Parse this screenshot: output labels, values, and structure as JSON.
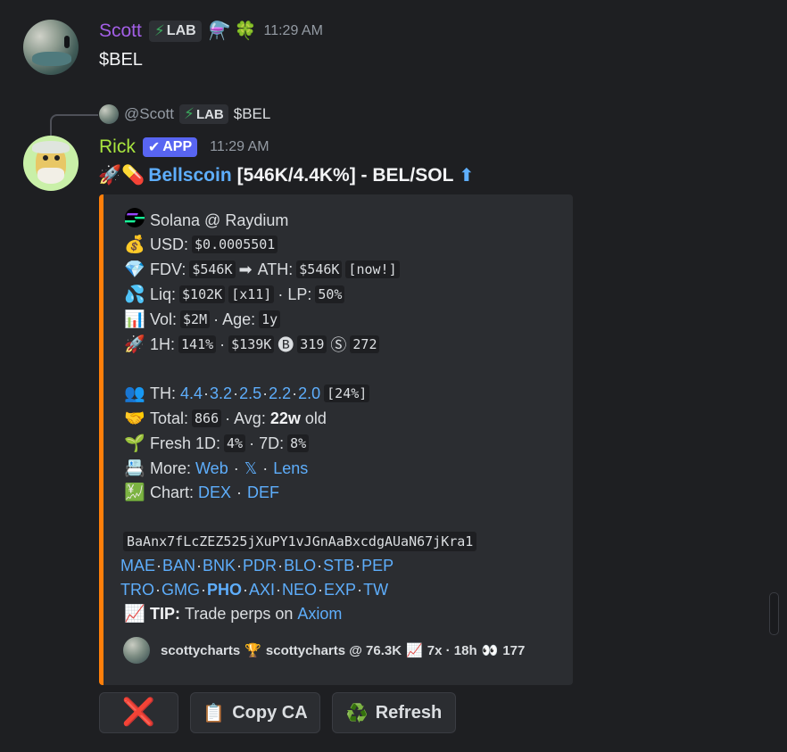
{
  "message1": {
    "author": "Scott",
    "author_color": "#a35fe6",
    "tag": "LAB",
    "badges": [
      "⚗️",
      "🍀"
    ],
    "time": "11:29 AM",
    "text": "$BEL"
  },
  "reply": {
    "mention": "@Scott",
    "tag": "LAB",
    "text": "$BEL"
  },
  "message2": {
    "author": "Rick",
    "author_color": "#a9e63f",
    "app_tag": "APP",
    "time": "11:29 AM",
    "title_emoji": "🚀💊",
    "title_link": "Bellscoin",
    "title_rest": "[546K/4.4K%] - BEL/SOL",
    "title_arrow": "⬆"
  },
  "embed": {
    "accent": "#ff7f0a",
    "chain": "Solana @ Raydium",
    "usd_label": "USD:",
    "usd_value": "$0.0005501",
    "fdv_label": "FDV:",
    "fdv_value": "$546K",
    "arrow": "➡",
    "ath_label": "ATH:",
    "ath_value": "$546K",
    "ath_note": "[now!]",
    "liq_label": "Liq:",
    "liq_value": "$102K",
    "liq_mult": "[x11]",
    "lp_label": "· LP:",
    "lp_value": "50%",
    "vol_label": "Vol:",
    "vol_value": "$2M",
    "age_label": "· Age:",
    "age_value": "1y",
    "h1_label": "1H:",
    "h1_pct": "141%",
    "h1_dot": "·",
    "h1_vol": "$139K",
    "buys_icon": "🅑",
    "buys": "319",
    "sells_icon": "Ⓢ",
    "sells": "272",
    "th_label": "TH:",
    "th_values": [
      "4.4",
      "3.2",
      "2.5",
      "2.2",
      "2.0"
    ],
    "th_pct": "[24%]",
    "total_label": "Total:",
    "total_value": "866",
    "avg_label": "· Avg:",
    "avg_value": "22w",
    "avg_suffix": "old",
    "fresh_label": "Fresh 1D:",
    "fresh_1d": "4%",
    "fresh_7d_label": "· 7D:",
    "fresh_7d": "8%",
    "more_label": "More:",
    "more_links": [
      "Web",
      "𝕏",
      "Lens"
    ],
    "chart_label": "Chart:",
    "chart_links": [
      "DEX",
      "DEF"
    ],
    "ca": "BaAnx7fLcZEZ525jXuPY1vJGnAaBxcdgAUaN67jKra1",
    "links_row1": [
      "MAE",
      "BAN",
      "BNK",
      "PDR",
      "BLO",
      "STB",
      "PEP"
    ],
    "links_row2": [
      "TRO",
      "GMG",
      "PHO",
      "AXI",
      "NEO",
      "EXP",
      "TW"
    ],
    "tip_label": "TIP:",
    "tip_text": "Trade perps on",
    "tip_link": "Axiom",
    "footer": {
      "user": "scottycharts",
      "trophy": "🏆",
      "user_at": "scottycharts @ 76.3K",
      "chart_icon": "📈",
      "stats": "7x · 18h",
      "eyes_icon": "👀",
      "views": "177"
    },
    "icons": {
      "chain": "🟣",
      "usd": "💰",
      "fdv": "💎",
      "liq": "💦",
      "vol": "📊",
      "h1": "🚀",
      "th": "👥",
      "total": "🤝",
      "fresh": "🌱",
      "more": "📇",
      "chart": "💹",
      "tip": "📈"
    }
  },
  "buttons": {
    "close": "❌",
    "copy_icon": "📋",
    "copy_label": "Copy CA",
    "refresh_icon": "♻️",
    "refresh_label": "Refresh"
  }
}
